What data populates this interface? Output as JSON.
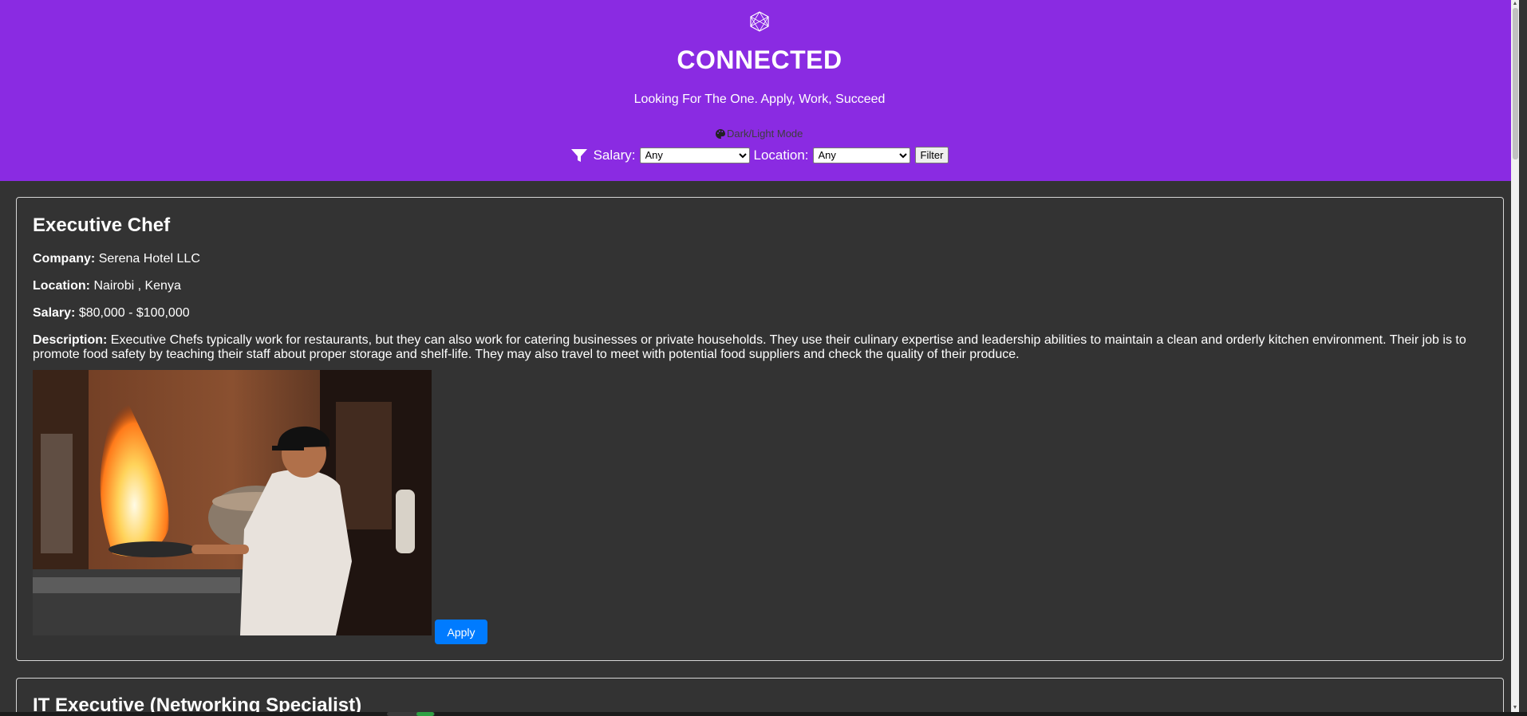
{
  "header": {
    "logo_icon": "hexagon-logo-icon",
    "title": "CONNECTED",
    "tagline": "Looking For The One. Apply, Work, Succeed",
    "theme_toggle": "Dark/Light Mode",
    "theme_toggle_icon": "palette-icon",
    "background_color": "#8a2be2"
  },
  "filters": {
    "icon": "filter-icon",
    "salary_label": "Salary:",
    "salary_value": "Any",
    "location_label": "Location:",
    "location_value": "Any",
    "filter_button": "Filter"
  },
  "jobs": [
    {
      "title": "Executive Chef",
      "company_label": "Company:",
      "company": "Serena Hotel LLC",
      "location_label": "Location:",
      "location": "Nairobi , Kenya",
      "salary_label": "Salary:",
      "salary": "$80,000 - $100,000",
      "description_label": "Description:",
      "description": "Executive Chefs typically work for restaurants, but they can also work for catering businesses or private households. They use their culinary expertise and leadership abilities to maintain a clean and orderly kitchen environment. Their job is to promote food safety by teaching their staff about proper storage and shelf-life. They may also travel to meet with potential food suppliers and check the quality of their produce.",
      "apply_label": "Apply"
    },
    {
      "title": "IT Executive (Networking Specialist)"
    }
  ],
  "colors": {
    "page_background": "#333333",
    "apply_button": "#007bff",
    "card_border": "#d6d6d6"
  }
}
